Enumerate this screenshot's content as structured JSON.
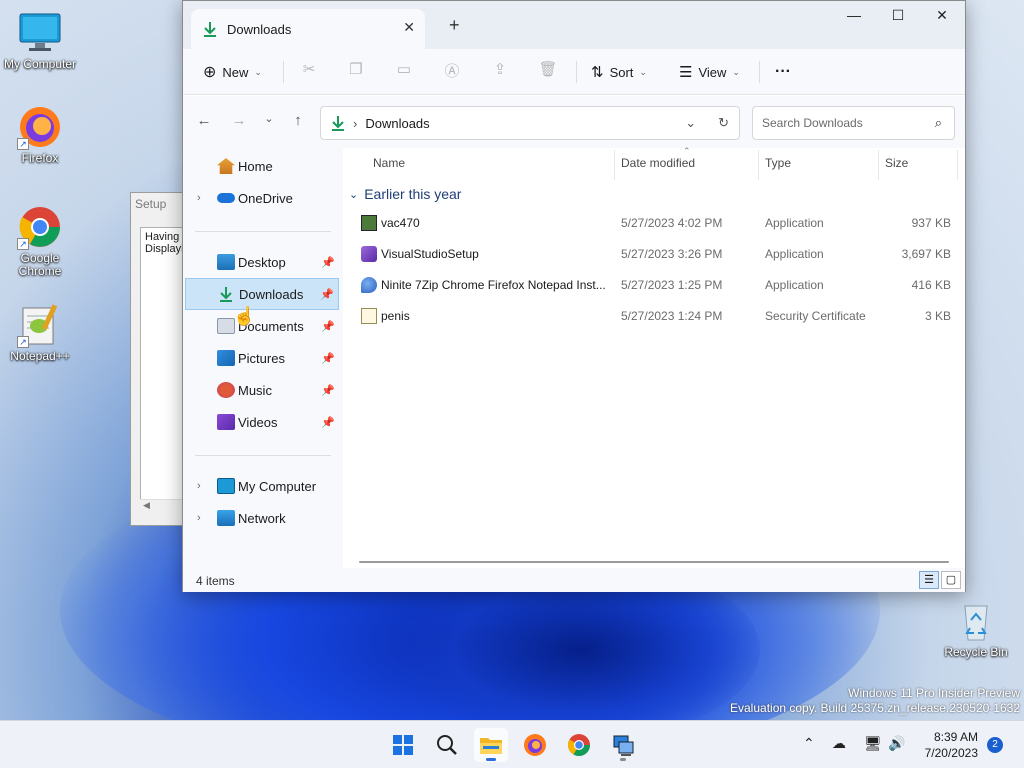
{
  "desktop": {
    "icons": [
      {
        "label": "My Computer"
      },
      {
        "label": "Firefox"
      },
      {
        "label": "Google Chrome"
      },
      {
        "label": "Notepad++"
      },
      {
        "label": "Recycle Bin"
      }
    ],
    "watermark_line1": "Windows 11 Pro Insider Preview",
    "watermark_line2": "Evaluation copy. Build 25375.zn_release.230520-1632"
  },
  "setup_window": {
    "title": "Setup",
    "text_line1": "Having",
    "text_line2": "Displayi"
  },
  "explorer": {
    "tab_title": "Downloads",
    "new_tab": "+",
    "toolbar": {
      "new_label": "New",
      "sort_label": "Sort",
      "view_label": "View",
      "more_label": "···"
    },
    "address": {
      "path": "Downloads",
      "search_placeholder": "Search Downloads"
    },
    "sidebar": {
      "home": "Home",
      "onedrive": "OneDrive",
      "desktop": "Desktop",
      "downloads": "Downloads",
      "documents": "Documents",
      "pictures": "Pictures",
      "music": "Music",
      "videos": "Videos",
      "my_computer": "My Computer",
      "network": "Network"
    },
    "columns": {
      "name": "Name",
      "date": "Date modified",
      "type": "Type",
      "size": "Size"
    },
    "group_label": "Earlier this year",
    "files": [
      {
        "name": "vac470",
        "date": "5/27/2023 4:02 PM",
        "type": "Application",
        "size": "937 KB"
      },
      {
        "name": "VisualStudioSetup",
        "date": "5/27/2023 3:26 PM",
        "type": "Application",
        "size": "3,697 KB"
      },
      {
        "name": "Ninite 7Zip Chrome Firefox Notepad Inst...",
        "date": "5/27/2023 1:25 PM",
        "type": "Application",
        "size": "416 KB"
      },
      {
        "name": "penis",
        "date": "5/27/2023 1:24 PM",
        "type": "Security Certificate",
        "size": "3 KB"
      }
    ],
    "status": "4 items"
  },
  "taskbar": {
    "time": "8:39 AM",
    "date": "7/20/2023",
    "notification_count": "2"
  },
  "colors": {
    "accent": "#1a5fd0",
    "selection": "#cce4f7"
  }
}
